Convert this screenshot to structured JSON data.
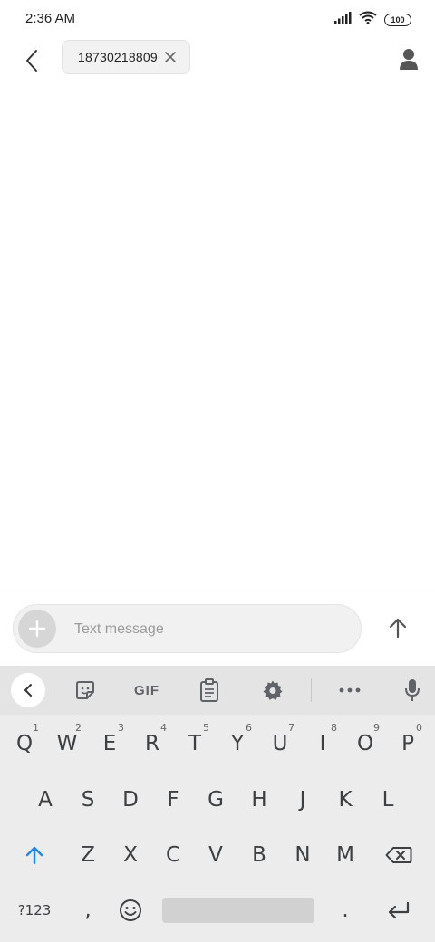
{
  "status_bar": {
    "time": "2:36 AM",
    "battery": "100",
    "icons": [
      "signal-icon",
      "wifi-icon",
      "battery-icon"
    ]
  },
  "header": {
    "recipient": "18730218809",
    "icons": [
      "back-arrow-icon",
      "close-icon",
      "person-icon"
    ]
  },
  "composer": {
    "placeholder": "Text message",
    "value": "",
    "icons": [
      "plus-icon",
      "send-arrow-icon"
    ]
  },
  "keyboard": {
    "toolbar": {
      "gif_label": "GIF",
      "icons": [
        "chevron-left-icon",
        "sticker-icon",
        "clipboard-icon",
        "gear-icon",
        "more-dots-icon",
        "microphone-icon"
      ]
    },
    "row1": [
      {
        "key": "Q",
        "hint": "1"
      },
      {
        "key": "W",
        "hint": "2"
      },
      {
        "key": "E",
        "hint": "3"
      },
      {
        "key": "R",
        "hint": "4"
      },
      {
        "key": "T",
        "hint": "5"
      },
      {
        "key": "Y",
        "hint": "6"
      },
      {
        "key": "U",
        "hint": "7"
      },
      {
        "key": "I",
        "hint": "8"
      },
      {
        "key": "O",
        "hint": "9"
      },
      {
        "key": "P",
        "hint": "0"
      }
    ],
    "row2": [
      "A",
      "S",
      "D",
      "F",
      "G",
      "H",
      "J",
      "K",
      "L"
    ],
    "row3": [
      "Z",
      "X",
      "C",
      "V",
      "B",
      "N",
      "M"
    ],
    "row4": {
      "symbols": "?123",
      "comma": ",",
      "period": "."
    }
  },
  "colors": {
    "accent_blue": "#1e88e5",
    "key_text": "#3c4043",
    "keyboard_bg": "#ececec",
    "toolbar_bg": "#e4e4e4"
  }
}
